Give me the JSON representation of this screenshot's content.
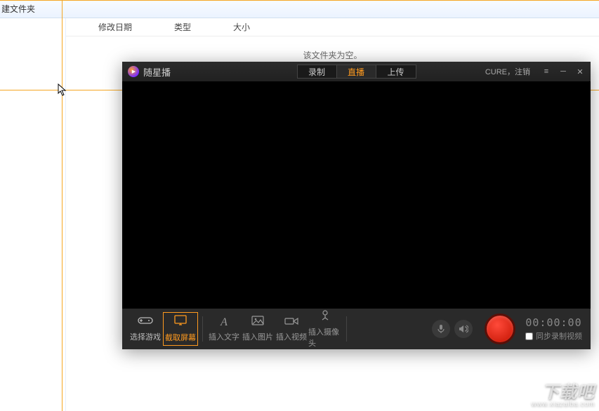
{
  "explorer": {
    "toolbar_new_folder": "建文件夹",
    "columns": {
      "mod_date": "修改日期",
      "type": "类型",
      "size": "大小"
    },
    "empty_message": "该文件夹为空。"
  },
  "app": {
    "title": "随星播",
    "tabs": {
      "record": "录制",
      "live": "直播",
      "upload": "上传"
    },
    "user_label": "CURE，注销",
    "sources": {
      "select_game": "选择游戏",
      "capture_screen": "截取屏幕"
    },
    "tools": {
      "insert_text": "插入文字",
      "insert_image": "插入图片",
      "insert_video": "插入视频",
      "insert_camera": "插入摄像头"
    },
    "timer": "00:00:00",
    "sync_label": "同步录制视频"
  },
  "watermark": {
    "main": "下载吧",
    "sub": "www.xiazaiba.com"
  }
}
